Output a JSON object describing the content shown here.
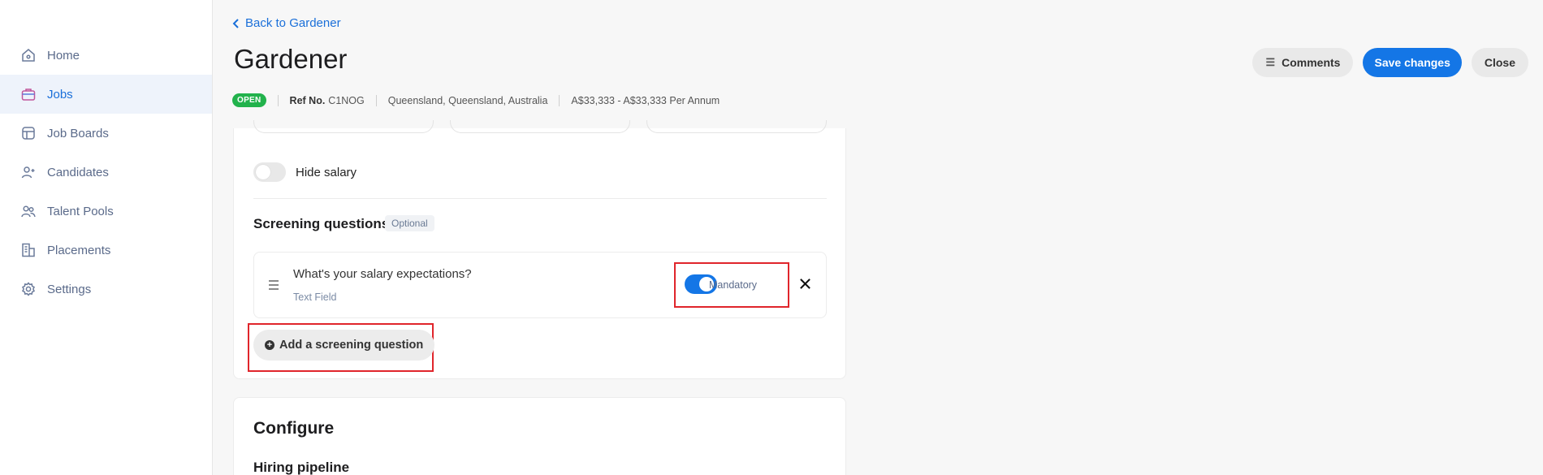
{
  "sidebar": {
    "items": [
      {
        "label": "Home",
        "icon": "home-icon"
      },
      {
        "label": "Jobs",
        "icon": "briefcase-icon",
        "active": true
      },
      {
        "label": "Job Boards",
        "icon": "job-boards-icon"
      },
      {
        "label": "Candidates",
        "icon": "candidates-icon"
      },
      {
        "label": "Talent Pools",
        "icon": "talent-pools-icon"
      },
      {
        "label": "Placements",
        "icon": "placements-icon"
      },
      {
        "label": "Settings",
        "icon": "gear-icon"
      }
    ]
  },
  "header": {
    "back_label": "Back to Gardener",
    "title": "Gardener",
    "status": "OPEN",
    "ref_label": "Ref No.",
    "ref_value": "C1NOG",
    "location": "Queensland, Queensland, Australia",
    "salary": "A$33,333 - A$33,333 Per Annum",
    "actions": {
      "comments_label": "Comments",
      "save_label": "Save changes",
      "close_label": "Close"
    }
  },
  "salary_section": {
    "hide_salary_label": "Hide salary",
    "hide_salary_on": false
  },
  "screening": {
    "title": "Screening questions",
    "optional_label": "Optional",
    "questions": [
      {
        "title": "What's your salary expectations?",
        "type": "Text Field",
        "mandatory_label": "Mandatory",
        "mandatory_on": true
      }
    ],
    "add_label": "Add a screening question"
  },
  "configure": {
    "title": "Configure",
    "hiring_pipeline_label": "Hiring pipeline"
  },
  "colors": {
    "accent": "#1476e6",
    "status_open": "#22b24c",
    "highlight": "#e0252b"
  }
}
